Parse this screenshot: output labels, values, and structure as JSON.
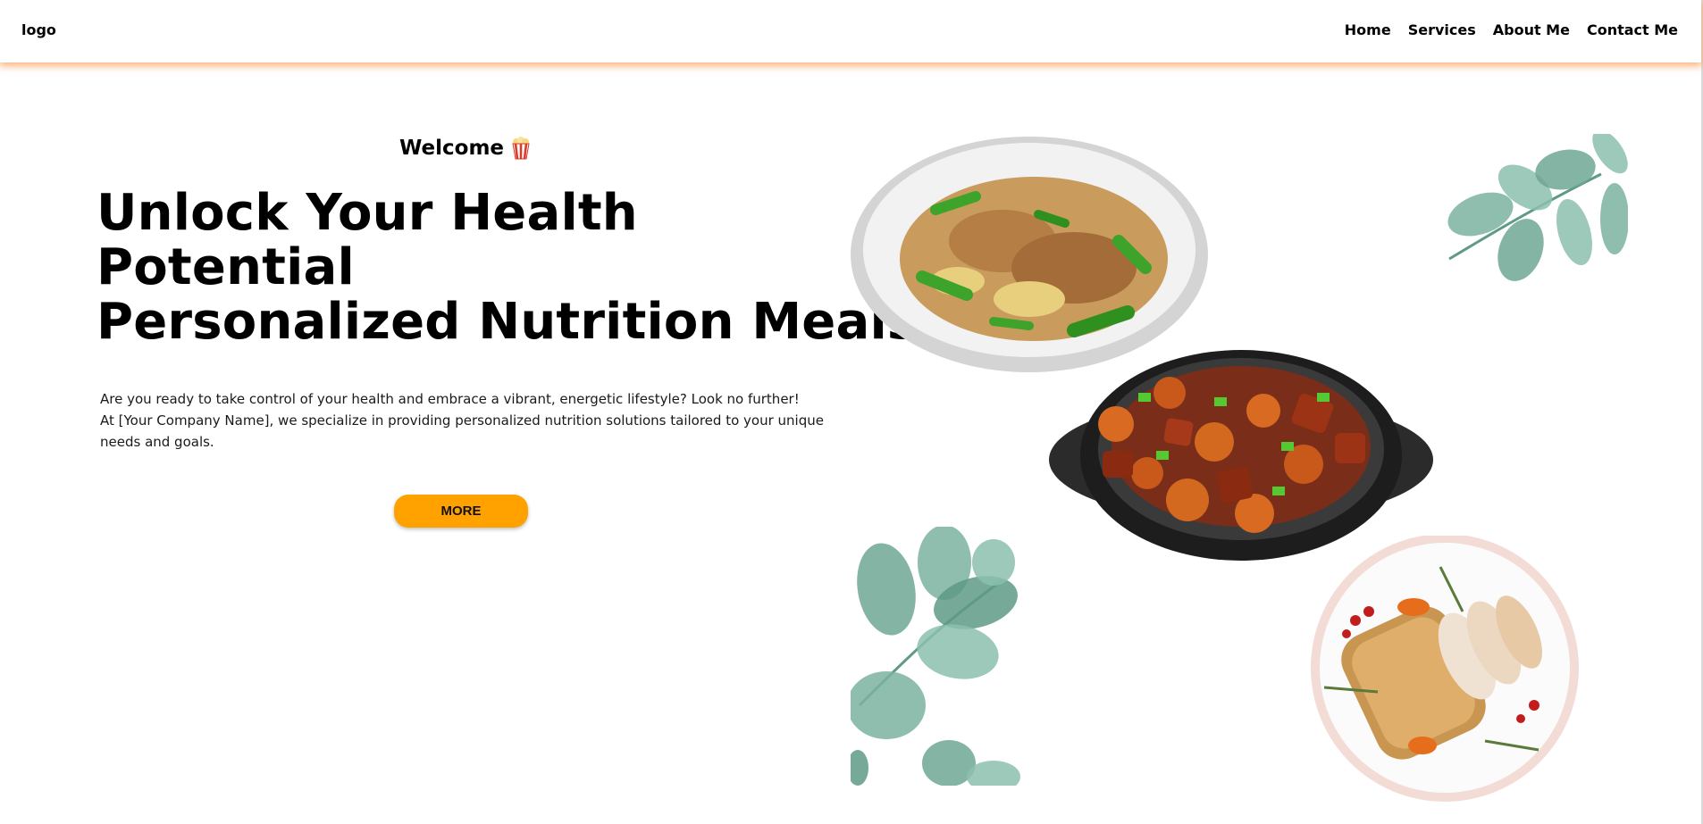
{
  "header": {
    "logo": "logo",
    "nav": [
      "Home",
      "Services",
      "About Me",
      "Contact Me"
    ]
  },
  "hero": {
    "welcome": "Welcome",
    "headline_lines": [
      "Unlock Your Health",
      "Potential",
      "Personalized Nutrition Meals"
    ],
    "paragraph_lines": [
      "Are you ready to take control of your health and embrace a vibrant, energetic lifestyle? Look no further!",
      "At [Your Company Name], we specialize in providing personalized nutrition solutions tailored to your unique needs and goals."
    ],
    "cta": "MORE"
  },
  "icons": {
    "welcome": "popcorn-icon"
  },
  "colors": {
    "accent": "#ffa200",
    "header_glow": "#ff9952",
    "leaf": "#6fa793"
  }
}
